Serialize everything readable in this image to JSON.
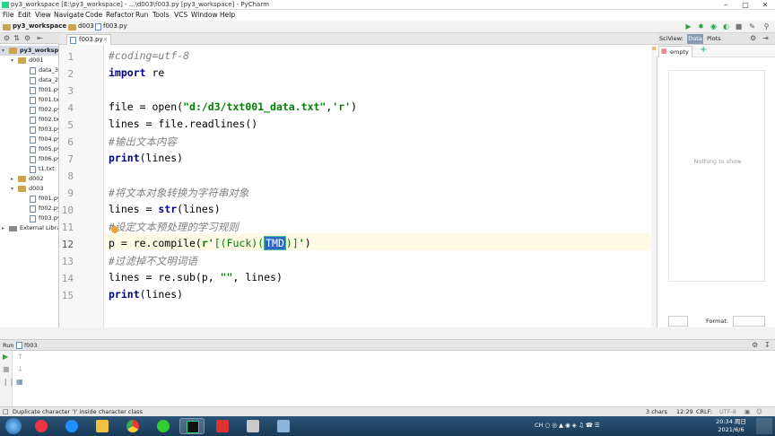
{
  "window": {
    "title": "py3_workspace [E:\\py3_workspace] - ...\\d003\\f003.py [py3_workspace] - PyCharm",
    "min_icon": "minimize-icon",
    "max_icon": "maximize-icon",
    "close_icon": "close-icon"
  },
  "menu": [
    "File",
    "Edit",
    "View",
    "Navigate",
    "Code",
    "Refactor",
    "Run",
    "Tools",
    "VCS",
    "Window",
    "Help"
  ],
  "breadcrumb": [
    "py3_workspace",
    "d003",
    "f003.py"
  ],
  "toolbar": {
    "run_config": "f003"
  },
  "project_tree": [
    {
      "label": "py3_workspac",
      "level": 0,
      "expanded": true,
      "type": "folder"
    },
    {
      "label": "d001",
      "level": 1,
      "expanded": true,
      "type": "folder"
    },
    {
      "label": "data_3...",
      "level": 2,
      "type": "file"
    },
    {
      "label": "data_21",
      "level": 2,
      "type": "file"
    },
    {
      "label": "f001.py",
      "level": 2,
      "type": "file"
    },
    {
      "label": "f001.txt",
      "level": 2,
      "type": "file"
    },
    {
      "label": "f002.py",
      "level": 2,
      "type": "file"
    },
    {
      "label": "f002.txt",
      "level": 2,
      "type": "file"
    },
    {
      "label": "f003.py",
      "level": 2,
      "type": "file"
    },
    {
      "label": "f004.py",
      "level": 2,
      "type": "file"
    },
    {
      "label": "f005.py",
      "level": 2,
      "type": "file"
    },
    {
      "label": "f006.py",
      "level": 2,
      "type": "file"
    },
    {
      "label": "t1.txt",
      "level": 2,
      "type": "file"
    },
    {
      "label": "d002",
      "level": 1,
      "expanded": false,
      "type": "folder"
    },
    {
      "label": "d003",
      "level": 1,
      "expanded": true,
      "type": "folder"
    },
    {
      "label": "f001.py",
      "level": 2,
      "type": "file"
    },
    {
      "label": "f002.py",
      "level": 2,
      "type": "file"
    },
    {
      "label": "f003.py",
      "level": 2,
      "type": "file"
    },
    {
      "label": "External Librar",
      "level": 0,
      "expanded": false,
      "type": "lib"
    }
  ],
  "editor": {
    "tab": "f003.py",
    "current_line": 12,
    "lines": [
      {
        "n": "1",
        "parts": [
          {
            "t": "#coding=utf-8",
            "c": "cm"
          }
        ]
      },
      {
        "n": "2",
        "parts": [
          {
            "t": "import",
            "c": "kw"
          },
          {
            "t": " re",
            "c": ""
          }
        ]
      },
      {
        "n": "3",
        "parts": []
      },
      {
        "n": "4",
        "parts": [
          {
            "t": "file = open(",
            "c": ""
          },
          {
            "t": "\"d:/d3/txt001_data.txt\"",
            "c": "st"
          },
          {
            "t": ",",
            "c": ""
          },
          {
            "t": "'r'",
            "c": "st"
          },
          {
            "t": ")",
            "c": ""
          }
        ]
      },
      {
        "n": "5",
        "parts": [
          {
            "t": "lines = file.readlines()",
            "c": ""
          }
        ]
      },
      {
        "n": "6",
        "parts": [
          {
            "t": "#输出文本内容",
            "c": "cm"
          }
        ]
      },
      {
        "n": "7",
        "parts": [
          {
            "t": "print",
            "c": "kw"
          },
          {
            "t": "(lines)",
            "c": ""
          }
        ]
      },
      {
        "n": "8",
        "parts": []
      },
      {
        "n": "9",
        "parts": [
          {
            "t": "#将文本对象转换为字符串对象",
            "c": "cm"
          }
        ]
      },
      {
        "n": "10",
        "parts": [
          {
            "t": "lines = ",
            "c": ""
          },
          {
            "t": "str",
            "c": "kw"
          },
          {
            "t": "(lines)",
            "c": ""
          }
        ]
      },
      {
        "n": "11",
        "parts": [
          {
            "t": "#设定文本预处理的学习规则",
            "c": "cm"
          }
        ]
      },
      {
        "n": "12",
        "parts": [
          {
            "t": "p = re.compile(",
            "c": ""
          },
          {
            "t": "r'",
            "c": "st"
          },
          {
            "t": "[(Fuck)(",
            "c": "rx"
          },
          {
            "t": "TMD",
            "c": "sel"
          },
          {
            "t": ")]",
            "c": "rx"
          },
          {
            "t": "'",
            "c": "st"
          },
          {
            "t": ")",
            "c": ""
          }
        ]
      },
      {
        "n": "13",
        "parts": [
          {
            "t": "#过滤掉不文明词语",
            "c": "cm"
          }
        ]
      },
      {
        "n": "14",
        "parts": [
          {
            "t": "lines = re.sub(p, ",
            "c": ""
          },
          {
            "t": "\"\"",
            "c": "st"
          },
          {
            "t": ", lines)",
            "c": ""
          }
        ]
      },
      {
        "n": "15",
        "parts": [
          {
            "t": "print",
            "c": "kw"
          },
          {
            "t": "(lines)",
            "c": ""
          }
        ]
      }
    ]
  },
  "sciview": {
    "label": "SciView:",
    "tab_data": "Data",
    "tab_plots": "Plots",
    "empty_tab": "empty",
    "nothing_to_show": "Nothing to show",
    "format_label": "Format:"
  },
  "run": {
    "label": "Run",
    "config": "f003"
  },
  "status": {
    "message": "Duplicate character ')' inside character class",
    "chars": "3 chars",
    "position": "12:29",
    "line_sep": "CRLF:",
    "encoding": "UTF-8"
  },
  "taskbar": {
    "tray_text": "CH",
    "time": "20:34 周日",
    "date": "2021/6/6"
  }
}
